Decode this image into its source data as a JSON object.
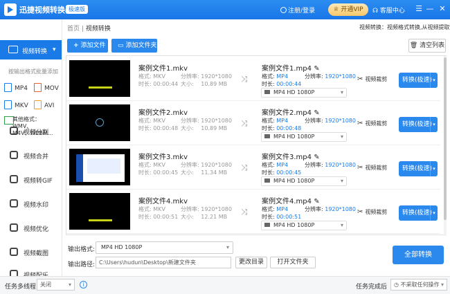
{
  "title_bar": {
    "app_title": "迅捷视频转换器",
    "edition_badge": "极速版",
    "login_label": "注册/登录",
    "vip_label": "开通VIP",
    "service_label": "客服中心",
    "window_buttons": [
      "☰",
      "—",
      "✕"
    ]
  },
  "sidebar": {
    "active_item": "视频转换",
    "hint": "按输出格式批量添加",
    "formats": [
      {
        "label": "MP4",
        "color": "#1a7ae8"
      },
      {
        "label": "MOV",
        "color": "#e85d2a"
      },
      {
        "label": "MKV",
        "color": "#1a7ae8"
      },
      {
        "label": "AVI",
        "color": "#e8a020"
      }
    ],
    "other_formats": [
      "其他格式：WMV、",
      "M4V、WEBM..."
    ],
    "tools": [
      "视频分割",
      "视频合并",
      "视频转GIF",
      "视频水印",
      "视频优化",
      "视频截图",
      "视频配乐"
    ]
  },
  "breadcrumb": {
    "home": "首页",
    "sep": "|",
    "current": "视频转换"
  },
  "crumb_info": "视频转换：视频格式转换,从视频提取音频",
  "toolbar": {
    "add_file": "添加文件",
    "add_folder": "添加文件夹",
    "clear": "清空列表"
  },
  "src_labels": {
    "format": "格式:",
    "resolution": "分辨率:",
    "duration": "时长:",
    "size": "大小:"
  },
  "out_labels": {
    "format": "格式:",
    "resolution": "分辨率:",
    "duration": "时长:"
  },
  "files": [
    {
      "name": "案例文件1.mkv",
      "format": "MKV",
      "resolution": "1920*1080",
      "duration": "00:00:44",
      "size": "10.89 MB",
      "out_name": "案例文件1.mp4",
      "out_format": "MP4",
      "out_resolution": "1920*1080",
      "out_duration": "00:00:44",
      "preset": "MP4  HD 1080P",
      "edit": "视频裁剪",
      "convert": "转换(极速)"
    },
    {
      "name": "案例文件2.mkv",
      "format": "MKV",
      "resolution": "1920*1080",
      "duration": "00:00:48",
      "size": "10.89 MB",
      "out_name": "案例文件2.mp4",
      "out_format": "MP4",
      "out_resolution": "1920*1080",
      "out_duration": "00:00:48",
      "preset": "MP4  HD 1080P",
      "edit": "视频裁剪",
      "convert": "转换(极速)"
    },
    {
      "name": "案例文件3.mkv",
      "format": "MKV",
      "resolution": "1920*1080",
      "duration": "00:00:45",
      "size": "11.34 MB",
      "out_name": "案例文件3.mp4",
      "out_format": "MP4",
      "out_resolution": "1920*1080",
      "out_duration": "00:00:45",
      "preset": "MP4  HD 1080P",
      "edit": "视频裁剪",
      "convert": "转换(极速)"
    },
    {
      "name": "案例文件4.mkv",
      "format": "MKV",
      "resolution": "1920*1080",
      "duration": "00:00:51",
      "size": "12.21 MB",
      "out_name": "案例文件4.mp4",
      "out_format": "MP4",
      "out_resolution": "1920*1080",
      "out_duration": "00:00:51",
      "preset": "MP4  HD 1080P",
      "edit": "视频裁剪",
      "convert": "转换(极速)"
    }
  ],
  "bottom": {
    "output_format_label": "输出格式:",
    "output_format_value": "MP4  HD 1080P",
    "output_path_label": "输出路径:",
    "output_path_value": "C:\\Users\\hudun\\Desktop\\新建文件夹",
    "change_dir": "更改目录",
    "open_folder": "打开文件夹",
    "convert_all": "全部转换"
  },
  "status_bar": {
    "multithread_label": "任务多线程",
    "multithread_value": "关闭",
    "info_icon": "i",
    "after_label": "任务完成后",
    "after_value": "不采取任何操作"
  }
}
